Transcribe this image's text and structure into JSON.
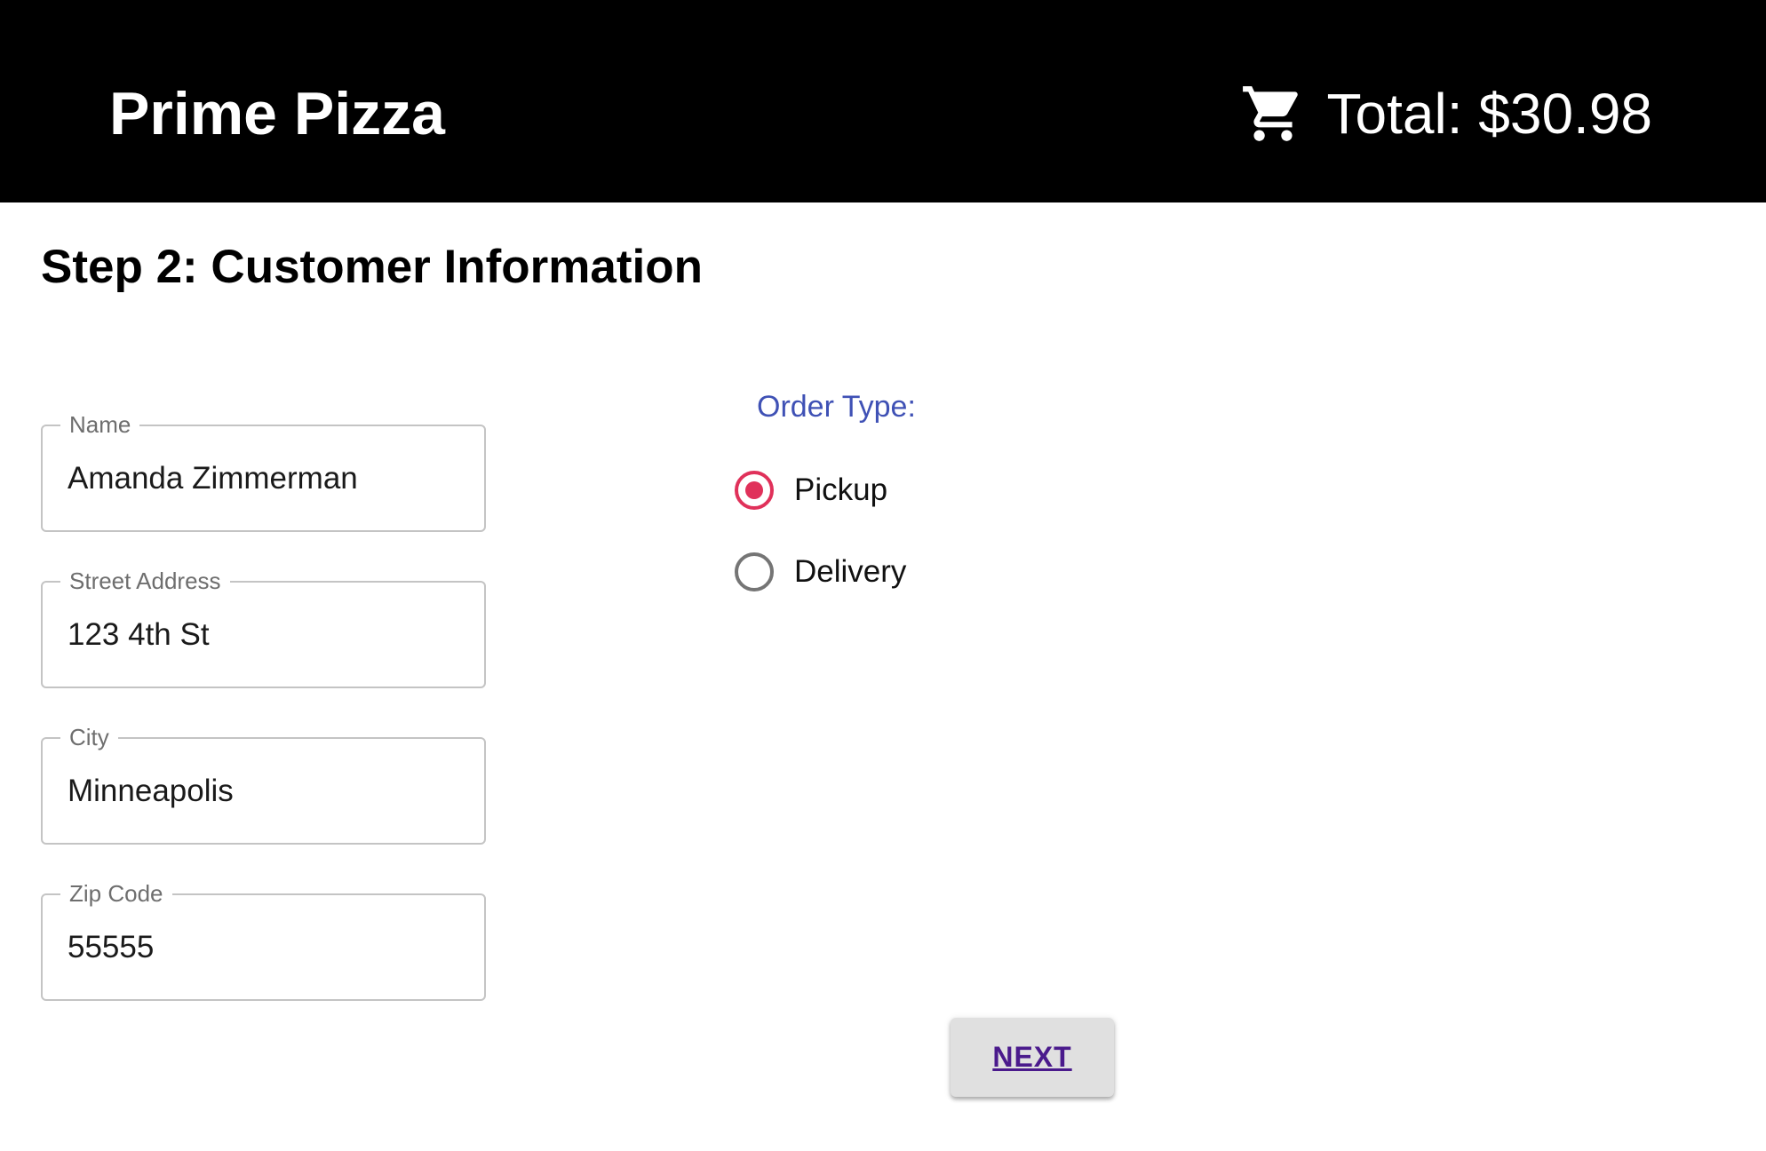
{
  "header": {
    "brand": "Prime Pizza",
    "cart_icon": "shopping-cart-icon",
    "total_text": "Total: $30.98"
  },
  "page": {
    "title": "Step 2: Customer Information"
  },
  "form": {
    "name": {
      "label": "Name",
      "value": "Amanda Zimmerman"
    },
    "street": {
      "label": "Street Address",
      "value": "123 4th St"
    },
    "city": {
      "label": "City",
      "value": "Minneapolis"
    },
    "zip": {
      "label": "Zip Code",
      "value": "55555"
    }
  },
  "order_type": {
    "label": "Order Type:",
    "options": [
      {
        "label": "Pickup",
        "selected": true
      },
      {
        "label": "Delivery",
        "selected": false
      }
    ]
  },
  "actions": {
    "next_label": "NEXT"
  },
  "colors": {
    "header_bg": "#000000",
    "accent_label": "#3f51b5",
    "radio_selected": "#e0315a",
    "radio_unselected": "#757575",
    "button_text": "#4a1a8c"
  }
}
